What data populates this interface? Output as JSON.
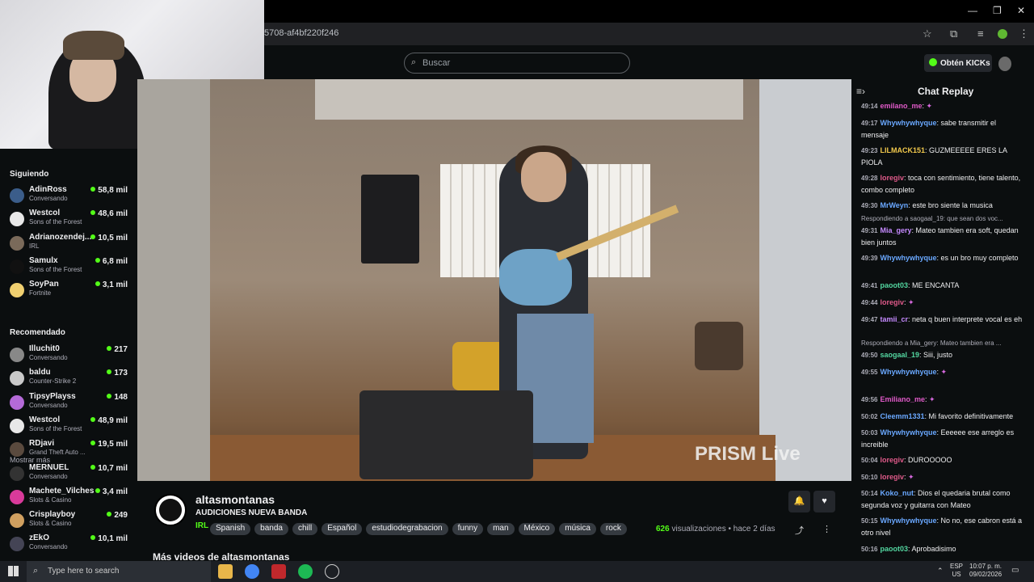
{
  "browser": {
    "url": "5708-af4bf220f246"
  },
  "search": {
    "placeholder": "Buscar"
  },
  "header": {
    "kicks_label": "Obtén KICKs"
  },
  "sidebar": {
    "following_title": "Siguiendo",
    "following": [
      {
        "name": "AdinRoss",
        "sub": "Conversando",
        "viewers": "58,8 mil",
        "color": "#3b5d8a"
      },
      {
        "name": "Westcol",
        "sub": "Sons of the Forest",
        "viewers": "48,6 mil",
        "color": "#e8e8e8"
      },
      {
        "name": "Adrianozendej...",
        "sub": "IRL",
        "viewers": "10,5 mil",
        "color": "#7a6a5a"
      },
      {
        "name": "Samulx",
        "sub": "Sons of the Forest",
        "viewers": "6,8 mil",
        "color": "#111"
      },
      {
        "name": "SoyPan",
        "sub": "Fortnite",
        "viewers": "3,1 mil",
        "color": "#f0d070"
      }
    ],
    "show_more": "Mostrar más",
    "recommended_title": "Recomendado",
    "recommended": [
      {
        "name": "Illuchit0",
        "sub": "Conversando",
        "viewers": "217",
        "color": "#888"
      },
      {
        "name": "baldu",
        "sub": "Counter-Strike 2",
        "viewers": "173",
        "color": "#c9c9c9"
      },
      {
        "name": "TipsyPlayss",
        "sub": "Conversando",
        "viewers": "148",
        "color": "#b46ad8"
      },
      {
        "name": "Westcol",
        "sub": "Sons of the Forest",
        "viewers": "48,9 mil",
        "color": "#e8e8e8"
      },
      {
        "name": "RDjavi",
        "sub": "Grand Theft Auto ...",
        "viewers": "19,5 mil",
        "color": "#5a4a3e"
      },
      {
        "name": "MERNUEL",
        "sub": "Conversando",
        "viewers": "10,7 mil",
        "color": "#333"
      },
      {
        "name": "Machete_Vilches",
        "sub": "Slots & Casino",
        "viewers": "3,4 mil",
        "color": "#d83a9a"
      },
      {
        "name": "Crisplayboy",
        "sub": "Slots & Casino",
        "viewers": "249",
        "color": "#d0a060"
      },
      {
        "name": "zEkO",
        "sub": "Conversando",
        "viewers": "10,1 mil",
        "color": "#445"
      }
    ]
  },
  "video": {
    "overlay": "PRISM Live"
  },
  "stream": {
    "channel": "altasmontanas",
    "title": "AUDICIONES NUEVA BANDA",
    "category": "IRL",
    "tags": [
      "Spanish",
      "banda",
      "chill",
      "Español",
      "estudiodegrabacion",
      "funny",
      "man",
      "México",
      "música",
      "rock"
    ],
    "views_count": "626",
    "views_label": "visualizaciones",
    "ago": "hace 2 días",
    "more_videos": "Más videos de altasmontanas"
  },
  "chat": {
    "title": "Chat Replay",
    "messages": [
      {
        "t": "49:14",
        "u": "emilano_me",
        "c": "#e05ac8",
        "m": ""
      },
      {
        "t": "49:17",
        "u": "Whywhywhyque",
        "c": "#6aa8ff",
        "m": "sabe transmitir el mensaje"
      },
      {
        "t": "49:23",
        "u": "LILMACK151",
        "c": "#f2c94c",
        "m": "GUZMEEEEE ERES LA PIOLA"
      },
      {
        "t": "49:28",
        "u": "loregiv",
        "c": "#e05a8a",
        "m": "toca con sentimiento, tiene talento, combo completo"
      },
      {
        "t": "49:30",
        "u": "MrWeyn",
        "c": "#6aa8ff",
        "m": "este bro siente la musica"
      },
      {
        "t": "49:31",
        "u": "Mia_gery",
        "c": "#c58aff",
        "m": "Mateo tambien era soft, quedan bien juntos"
      },
      {
        "t": "49:39",
        "u": "Whywhywhyque",
        "c": "#6aa8ff",
        "m": "es un bro muy completo"
      },
      {
        "t": "49:41",
        "u": "paoot03",
        "c": "#53d6a0",
        "m": "ME ENCANTA"
      },
      {
        "t": "49:44",
        "u": "loregiv",
        "c": "#e05a8a",
        "m": ""
      },
      {
        "t": "49:47",
        "u": "tamii_cr",
        "c": "#c58aff",
        "m": "neta q buen interprete vocal es eh"
      },
      {
        "t": "49:50",
        "u": "saogaal_19",
        "c": "#53d6a0",
        "m": "Siii, justo"
      },
      {
        "t": "49:55",
        "u": "Whywhywhyque",
        "c": "#6aa8ff",
        "m": ""
      },
      {
        "t": "49:56",
        "u": "Emiliano_me",
        "c": "#e05ac8",
        "m": ""
      },
      {
        "t": "50:02",
        "u": "Cleemm1331",
        "c": "#6aa8ff",
        "m": "Mi favorito definitivamente"
      },
      {
        "t": "50:03",
        "u": "Whywhywhyque",
        "c": "#6aa8ff",
        "m": "Eeeeee ese arreglo es increible"
      },
      {
        "t": "50:04",
        "u": "loregiv",
        "c": "#e05a8a",
        "m": "DUROOOOO"
      },
      {
        "t": "50:10",
        "u": "loregiv",
        "c": "#e05a8a",
        "m": ""
      },
      {
        "t": "50:14",
        "u": "Koko_nut",
        "c": "#6aa8ff",
        "m": "Dios el quedaria brutal como segunda voz y guitarra con Mateo"
      },
      {
        "t": "50:15",
        "u": "Whywhywhyque",
        "c": "#6aa8ff",
        "m": "No no, ese cabron está a otro nivel"
      },
      {
        "t": "50:16",
        "u": "paoot03",
        "c": "#53d6a0",
        "m": "Aprobadisimo"
      }
    ],
    "replies": [
      "Respondiendo a saogaal_19: que sean dos voc...",
      "Respondiendo a Mia_gery: Mateo tambien era ..."
    ]
  },
  "taskbar": {
    "search_placeholder": "Type here to search",
    "lang": "ESP",
    "region": "US",
    "time": "10:07 p. m.",
    "date": "09/02/2026"
  }
}
